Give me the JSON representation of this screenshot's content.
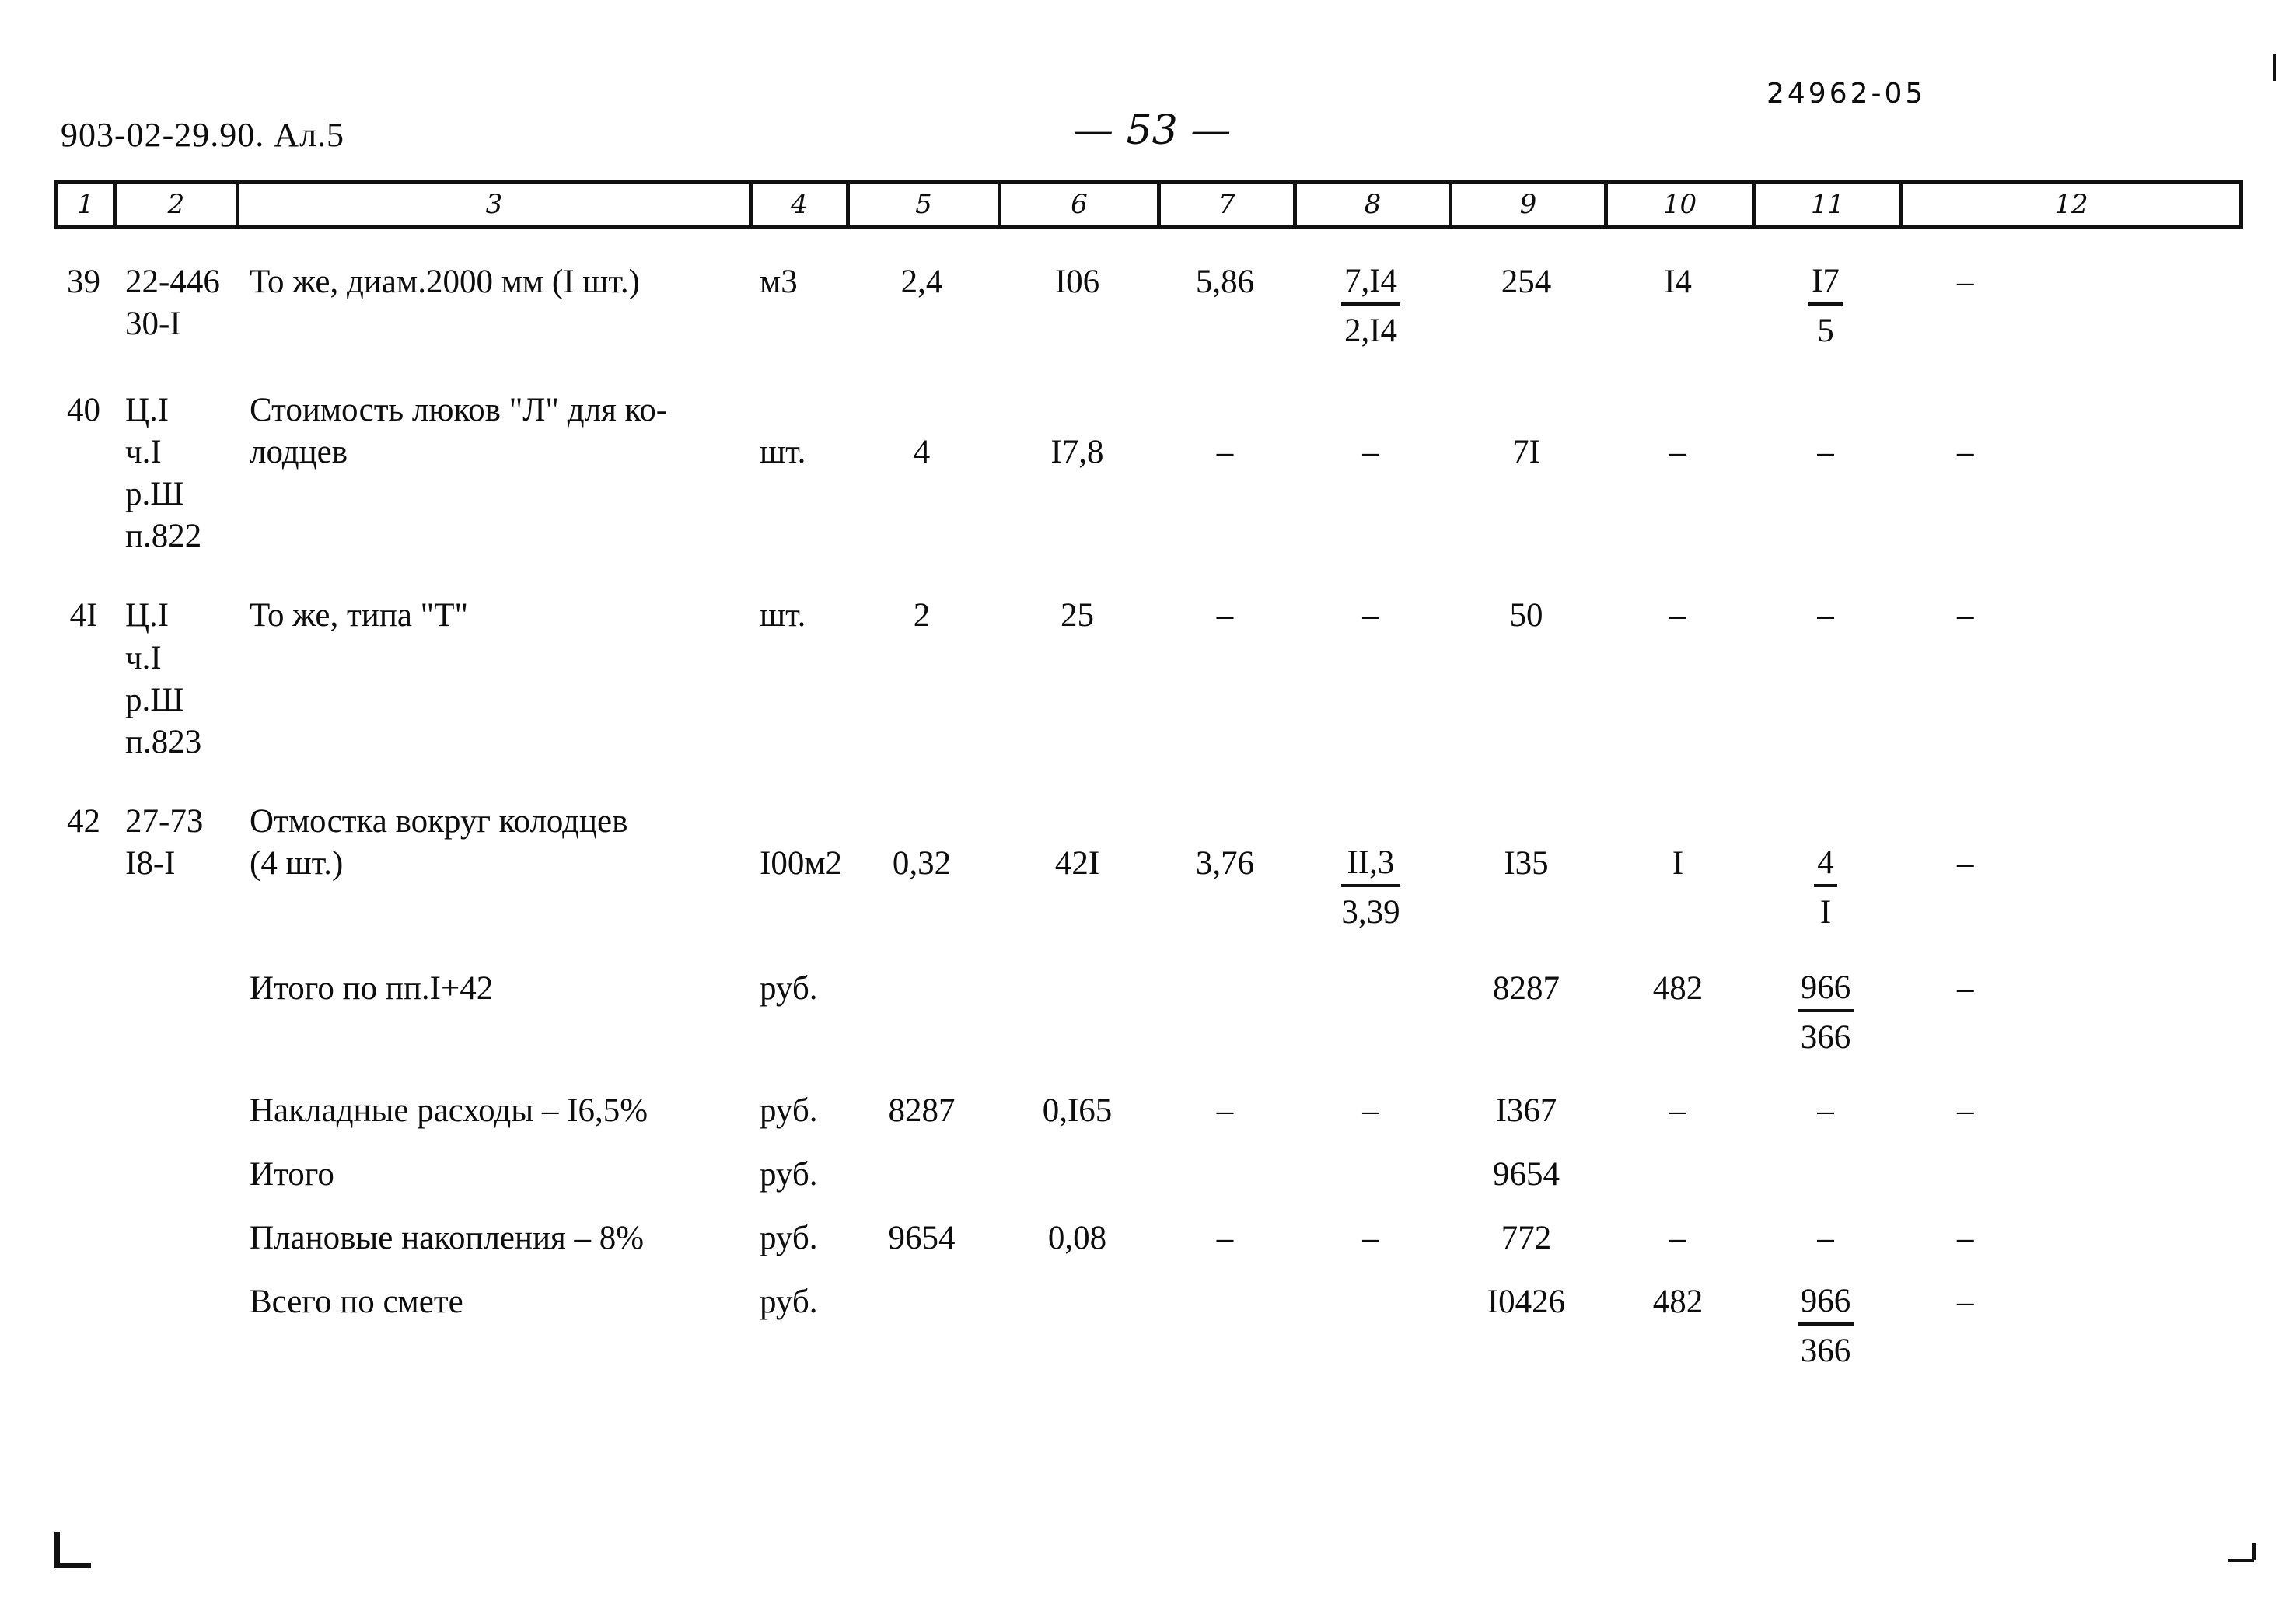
{
  "page": {
    "doc_code": "903-02-29.90. Ал.5",
    "page_number": "— 53 —",
    "archive_stamp": "24962-05"
  },
  "table": {
    "column_numbers": [
      "1",
      "2",
      "3",
      "4",
      "5",
      "6",
      "7",
      "8",
      "9",
      "10",
      "11",
      "12"
    ],
    "rows": [
      {
        "num": "39",
        "code_lines": [
          "22-446",
          "30-I"
        ],
        "desc_lines": [
          "То же, диам.2000 мм (I шт.)"
        ],
        "unit": "м3",
        "c5": "2,4",
        "c6": "I06",
        "c7": "5,86",
        "c8_top": "7,I4",
        "c8_bot": "2,I4",
        "c9": "254",
        "c10": "I4",
        "c11_top": "I7",
        "c11_bot": "5",
        "c12": "–"
      },
      {
        "num": "40",
        "code_lines": [
          "Ц.I",
          "ч.I",
          "р.Ш",
          "п.822"
        ],
        "desc_lines": [
          "Стоимость люков \"Л\" для ко-",
          "лодцев"
        ],
        "unit": "шт.",
        "c5": "4",
        "c6": "I7,8",
        "c7": "–",
        "c8_top": "–",
        "c8_bot": "",
        "c9": "7I",
        "c10": "–",
        "c11_top": "–",
        "c11_bot": "",
        "c12": "–"
      },
      {
        "num": "4I",
        "code_lines": [
          "Ц.I",
          "ч.I",
          "р.Ш",
          "п.823"
        ],
        "desc_lines": [
          "То же, типа \"Т\""
        ],
        "unit": "шт.",
        "c5": "2",
        "c6": "25",
        "c7": "–",
        "c8_top": "–",
        "c8_bot": "",
        "c9": "50",
        "c10": "–",
        "c11_top": "–",
        "c11_bot": "",
        "c12": "–"
      },
      {
        "num": "42",
        "code_lines": [
          "27-73",
          "I8-I"
        ],
        "desc_lines": [
          "Отмостка вокруг колодцев",
          "(4 шт.)"
        ],
        "unit": "I00м2",
        "c5": "0,32",
        "c6": "42I",
        "c7": "3,76",
        "c8_top": "II,3",
        "c8_bot": "3,39",
        "c9": "I35",
        "c10": "I",
        "c11_top": "4",
        "c11_bot": "I",
        "c12": "–"
      },
      {
        "num": "",
        "code_lines": [],
        "desc_lines": [
          "Итого по пп.I+42"
        ],
        "unit": "руб.",
        "c5": "",
        "c6": "",
        "c7": "",
        "c8_top": "",
        "c8_bot": "",
        "c9": "8287",
        "c10": "482",
        "c11_top": "966",
        "c11_bot": "366",
        "c12": "–"
      },
      {
        "num": "",
        "code_lines": [],
        "desc_lines": [
          "Накладные расходы – I6,5%"
        ],
        "unit": "руб.",
        "c5": "8287",
        "c6": "0,I65",
        "c7": "–",
        "c8_top": "–",
        "c8_bot": "",
        "c9": "I367",
        "c10": "–",
        "c11_top": "–",
        "c11_bot": "",
        "c12": "–"
      },
      {
        "num": "",
        "code_lines": [],
        "desc_lines": [
          "Итого"
        ],
        "unit": "руб.",
        "c5": "",
        "c6": "",
        "c7": "",
        "c8_top": "",
        "c8_bot": "",
        "c9": "9654",
        "c10": "",
        "c11_top": "",
        "c11_bot": "",
        "c12": ""
      },
      {
        "num": "",
        "code_lines": [],
        "desc_lines": [
          "Плановые накопления – 8%"
        ],
        "unit": "руб.",
        "c5": "9654",
        "c6": "0,08",
        "c7": "–",
        "c8_top": "–",
        "c8_bot": "",
        "c9": "772",
        "c10": "–",
        "c11_top": "–",
        "c11_bot": "",
        "c12": "–"
      },
      {
        "num": "",
        "code_lines": [],
        "desc_lines": [
          "Всего по смете"
        ],
        "unit": "руб.",
        "c5": "",
        "c6": "",
        "c7": "",
        "c8_top": "",
        "c8_bot": "",
        "c9": "I0426",
        "c10": "482",
        "c11_top": "966",
        "c11_bot": "366",
        "c12": "–"
      }
    ]
  }
}
